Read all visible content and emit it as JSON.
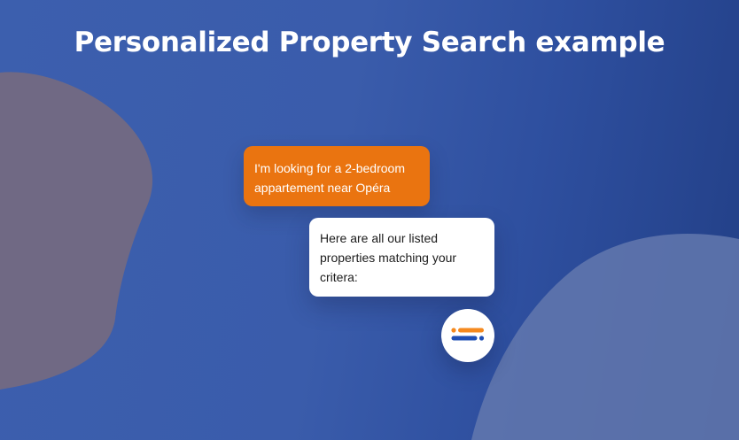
{
  "heading": {
    "title": "Personalized Property Search example"
  },
  "chat": {
    "user_message": "I'm looking for a 2-bedroom appartement near Opéra",
    "bot_message": "Here are all our listed properties matching your critera:",
    "bot_avatar_icon": "bot-logo-icon"
  },
  "colors": {
    "background": "#3a5cab",
    "user_bubble": "#ea7410",
    "bot_bubble": "#ffffff",
    "logo_orange": "#f5891e",
    "logo_blue": "#1f4fb5",
    "blob_left": "#776b7e",
    "blob_right": "#5b70a8"
  }
}
